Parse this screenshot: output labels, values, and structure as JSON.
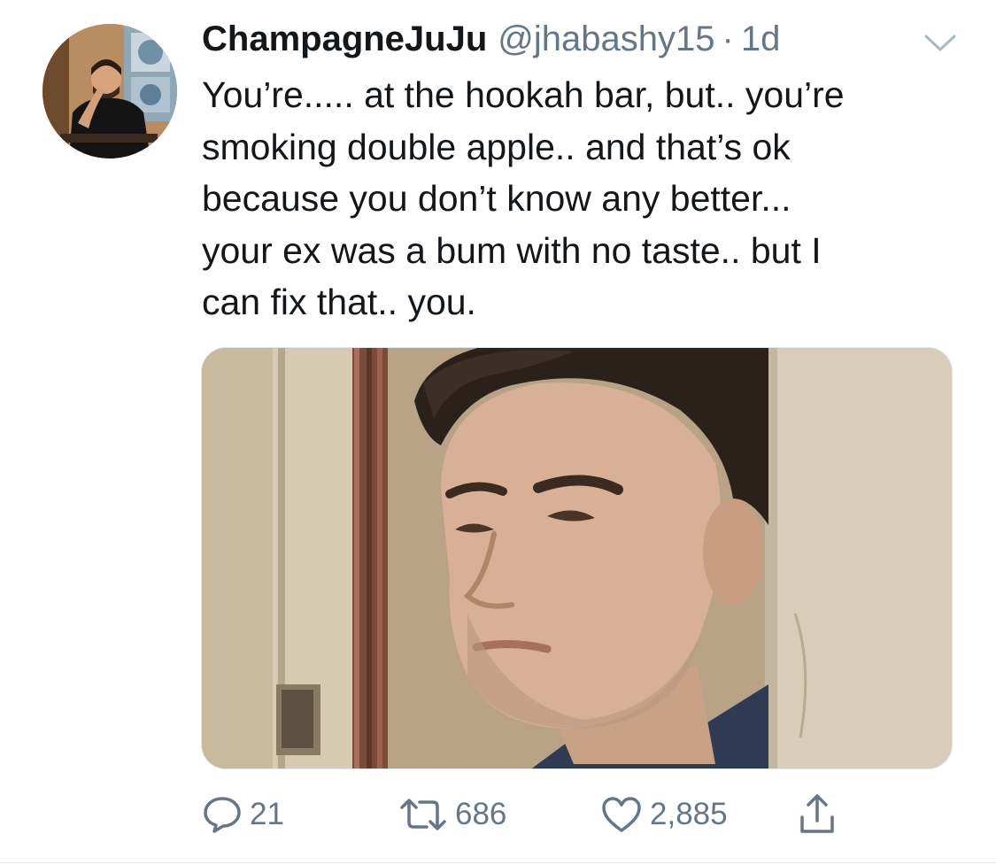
{
  "tweet": {
    "display_name": "ChampagneJuJu",
    "handle": "@jhabashy15",
    "separator": "·",
    "time": "1d",
    "text": "You’re..... at the hookah bar, but.. you’re\nsmoking double apple.. and that’s ok\nbecause you don’t know any better...\nyour ex was a bum with no taste.. but I\ncan fix that.. you.",
    "menu_icon": "chevron-down-icon",
    "avatar_icon": "avatar"
  },
  "actions": {
    "reply": {
      "icon": "reply-icon",
      "count": "21"
    },
    "retweet": {
      "icon": "retweet-icon",
      "count": "686"
    },
    "like": {
      "icon": "heart-icon",
      "count": "2,885"
    },
    "share": {
      "icon": "share-icon"
    }
  },
  "colors": {
    "primary_text": "#14171a",
    "secondary_text": "#657786",
    "border": "#e1e8ed"
  }
}
